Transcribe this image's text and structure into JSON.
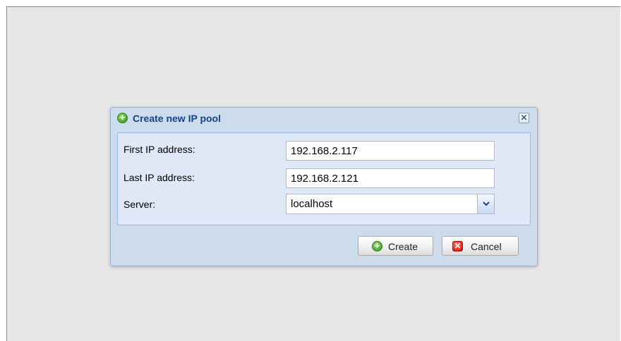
{
  "dialog": {
    "title": "Create new IP pool",
    "title_icon": "add-icon",
    "close_icon": "close-icon",
    "close_glyph": "✕"
  },
  "form": {
    "first_ip": {
      "label": "First IP address:",
      "value": "192.168.2.117"
    },
    "last_ip": {
      "label": "Last IP address:",
      "value": "192.168.2.121"
    },
    "server": {
      "label": "Server:",
      "selected": "localhost"
    }
  },
  "buttons": {
    "create": {
      "label": "Create",
      "icon": "add-icon",
      "glyph": "+"
    },
    "cancel": {
      "label": "Cancel",
      "icon": "cancel-icon",
      "glyph": "✕"
    }
  },
  "colors": {
    "title": "#15428b",
    "dialog_bg": "#cddcec",
    "panel_bg": "#dfe8f6",
    "create_icon": "#4aa82f",
    "cancel_icon": "#e0271b"
  }
}
